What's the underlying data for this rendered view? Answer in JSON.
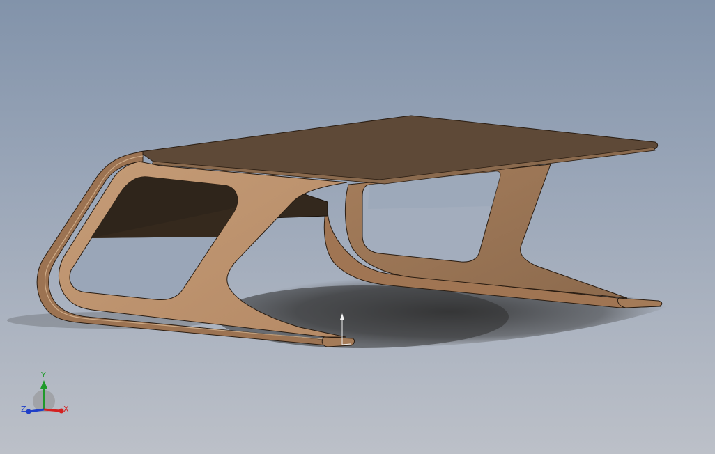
{
  "viewport": {
    "background_top": "#8293aa",
    "background_bottom": "#bcc0c8"
  },
  "model": {
    "part_color_light": "#bd9470",
    "part_color_dark": "#5e4937",
    "edge_color": "#2a1d12"
  },
  "origin_marker": {
    "icon": "origin-arrow-icon"
  },
  "triad": {
    "x_label": "X",
    "y_label": "Y",
    "z_label": "Z",
    "x_color": "#d42020",
    "y_color": "#1f9a2a",
    "z_color": "#1f3fc8"
  }
}
